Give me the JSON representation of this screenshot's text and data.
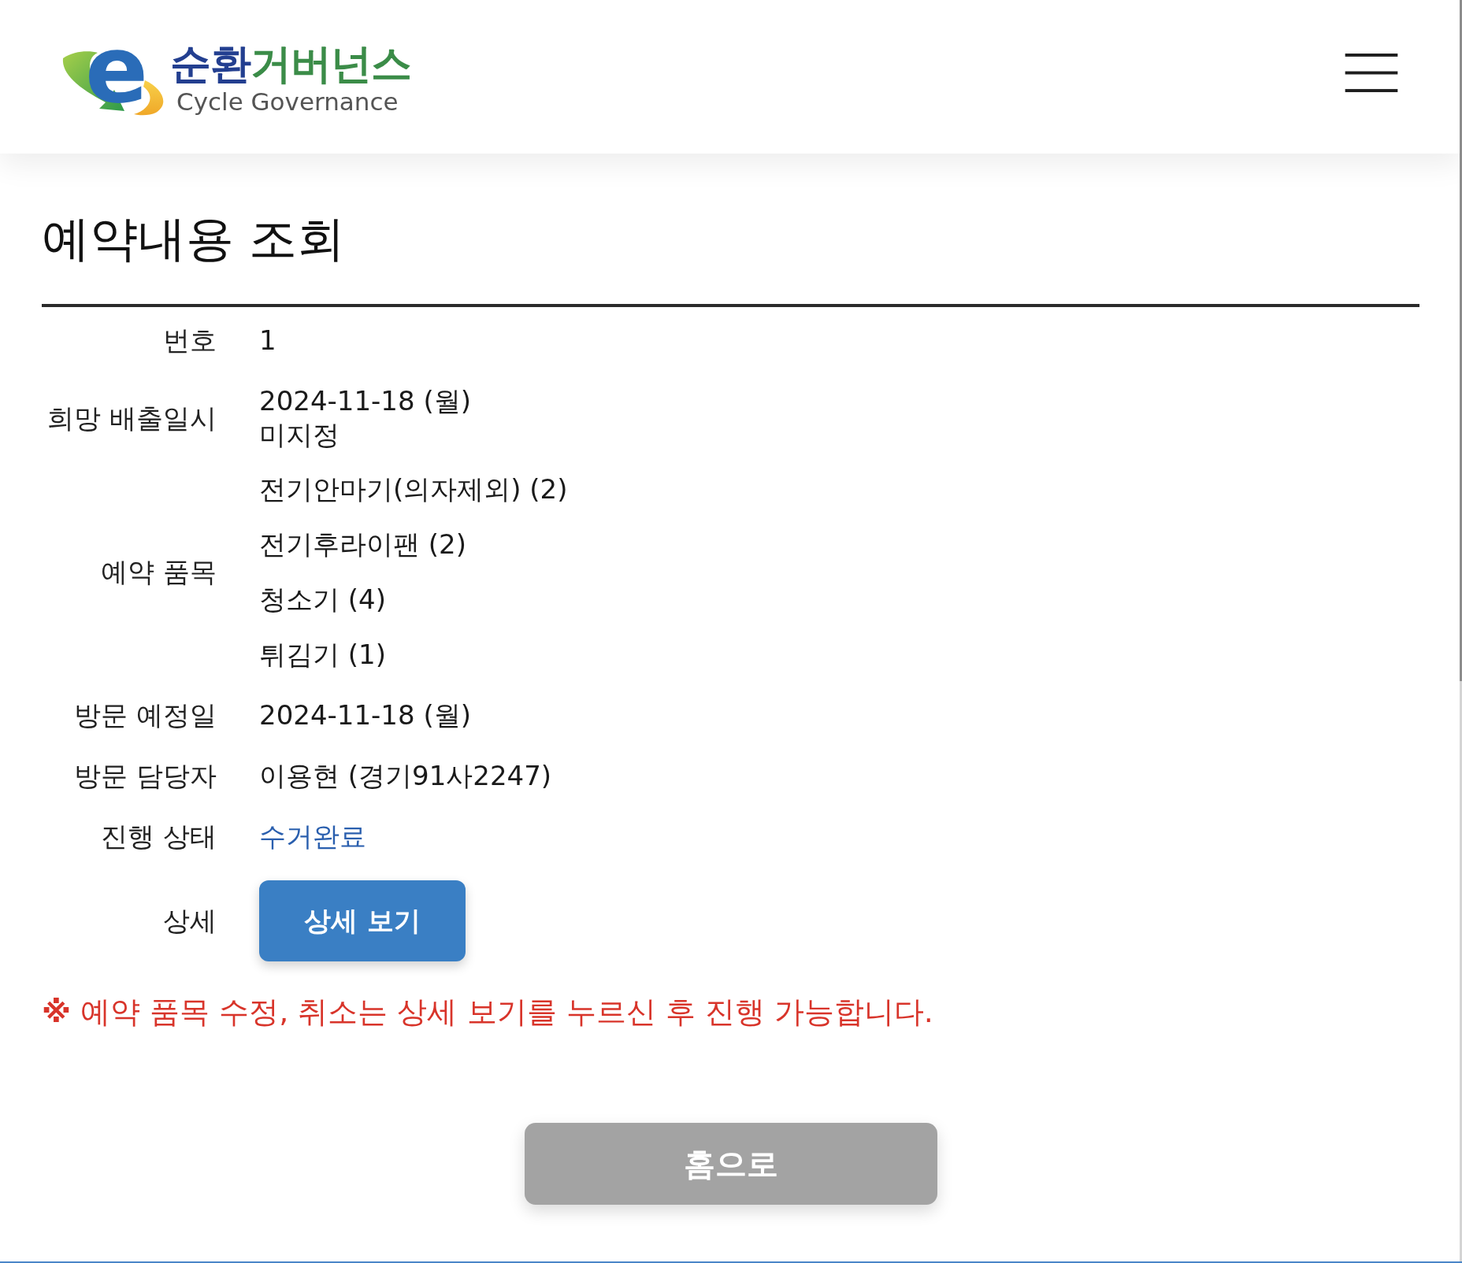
{
  "header": {
    "logo": {
      "mark": "e",
      "name_parts": [
        {
          "text": "순환",
          "color": "#233f90"
        },
        {
          "text": "거버넌스",
          "color": "#3b8c48"
        }
      ],
      "tagline": "Cycle Governance"
    }
  },
  "page": {
    "title": "예약내용 조회"
  },
  "details": {
    "rows": [
      {
        "label": "번호",
        "kind": "text",
        "value": "1"
      },
      {
        "label": "희망 배출일시",
        "kind": "lines",
        "lines": [
          "2024-11-18 (월)",
          "미지정"
        ]
      },
      {
        "label": "예약 품목",
        "kind": "list",
        "items": [
          "전기안마기(의자제외) (2)",
          "전기후라이팬 (2)",
          "청소기 (4)",
          "튀김기 (1)"
        ]
      },
      {
        "label": "방문 예정일",
        "kind": "text",
        "value": "2024-11-18 (월)"
      },
      {
        "label": "방문 담당자",
        "kind": "text",
        "value": "이용현 (경기91사2247)"
      },
      {
        "label": "진행 상태",
        "kind": "status",
        "value": "수거완료"
      },
      {
        "label": "상세",
        "kind": "button",
        "button": "상세 보기"
      }
    ]
  },
  "notice": "**※** 예약 품목 수정, 취소는 상세 보기를 누르신 후 진행 가능합니다.",
  "home_button": "홈으로"
}
